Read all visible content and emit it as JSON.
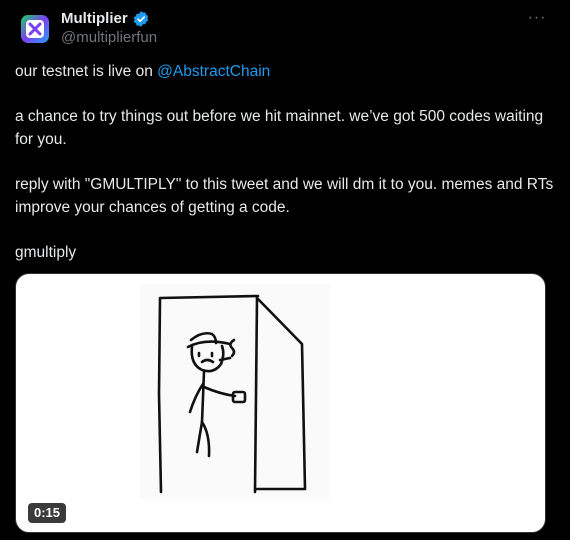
{
  "author": {
    "display_name": "Multiplier",
    "handle": "@multiplierfun",
    "avatar_icon": "multiplier-logo-icon",
    "verified": true
  },
  "more_icon": "more-options-icon",
  "more_label": "···",
  "tweet": {
    "line1_prefix": "our testnet is live on ",
    "mention": "@AbstractChain",
    "paragraph2": "a chance to try things out before we hit mainnet. we’ve got 500 codes waiting for you.",
    "paragraph3": "reply with \"GMULTIPLY\" to this tweet and we will dm it to you. memes and RTs improve your chances of getting a code.",
    "paragraph4": "gmultiply"
  },
  "media": {
    "type": "video",
    "thumbnail_icon": "stick-figure-doorway-drawing",
    "duration": "0:15"
  },
  "colors": {
    "background": "#000000",
    "text": "#e7e9ea",
    "secondary": "#71767b",
    "link": "#1d9bf0",
    "verified": "#1d9bf0"
  }
}
